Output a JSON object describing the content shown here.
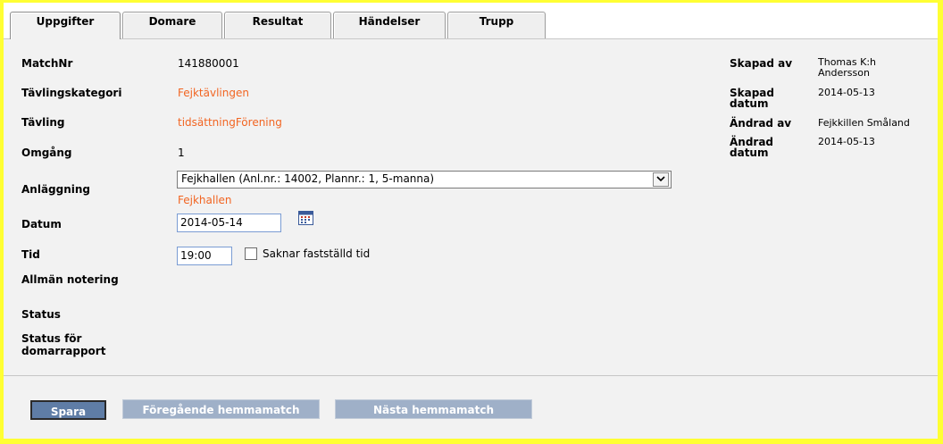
{
  "tabs": [
    {
      "label": "Uppgifter",
      "active": true
    },
    {
      "label": "Domare"
    },
    {
      "label": "Resultat"
    },
    {
      "label": "Händelser"
    },
    {
      "label": "Trupp"
    }
  ],
  "fields": {
    "matchnr_label": "MatchNr",
    "matchnr_value": "141880001",
    "kategori_label": "Tävlingskategori",
    "kategori_value": "Fejktävlingen",
    "tavling_label": "Tävling",
    "tavling_value": "tidsättningFörening",
    "omgang_label": "Omgång",
    "omgang_value": "1",
    "anlaggning_label": "Anläggning",
    "anlaggning_selected": "Fejkhallen (Anl.nr.: 14002, Plannr.: 1, 5-manna)",
    "anlaggning_link": "Fejkhallen",
    "datum_label": "Datum",
    "datum_value": "2014-05-14",
    "tid_label": "Tid",
    "tid_value": "19:00",
    "saknar_label": "Saknar fastställd tid",
    "notering_label": "Allmän notering",
    "status_label": "Status",
    "status_domar_label_1": "Status för",
    "status_domar_label_2": "domarrapport"
  },
  "meta": {
    "skapad_av_label": "Skapad av",
    "skapad_av_value_1": "Thomas K:h",
    "skapad_av_value_2": "Andersson",
    "skapad_datum_label_1": "Skapad",
    "skapad_datum_label_2": "datum",
    "skapad_datum_value": "2014-05-13",
    "andrad_av_label": "Ändrad av",
    "andrad_av_value": "Fejkkillen Småland",
    "andrad_datum_label_1": "Ändrad",
    "andrad_datum_label_2": "datum",
    "andrad_datum_value": "2014-05-13"
  },
  "buttons": {
    "save": "Spara",
    "prev": "Föregående hemmamatch",
    "next": "Nästa hemmamatch"
  },
  "colors": {
    "frame": "#ffff33",
    "link": "#f26522",
    "button_primary": "#5f7da6",
    "button_disabled": "#9fb0c8"
  },
  "icons": {
    "calendar": "calendar-icon",
    "dropdown": "chevron-down-icon"
  }
}
